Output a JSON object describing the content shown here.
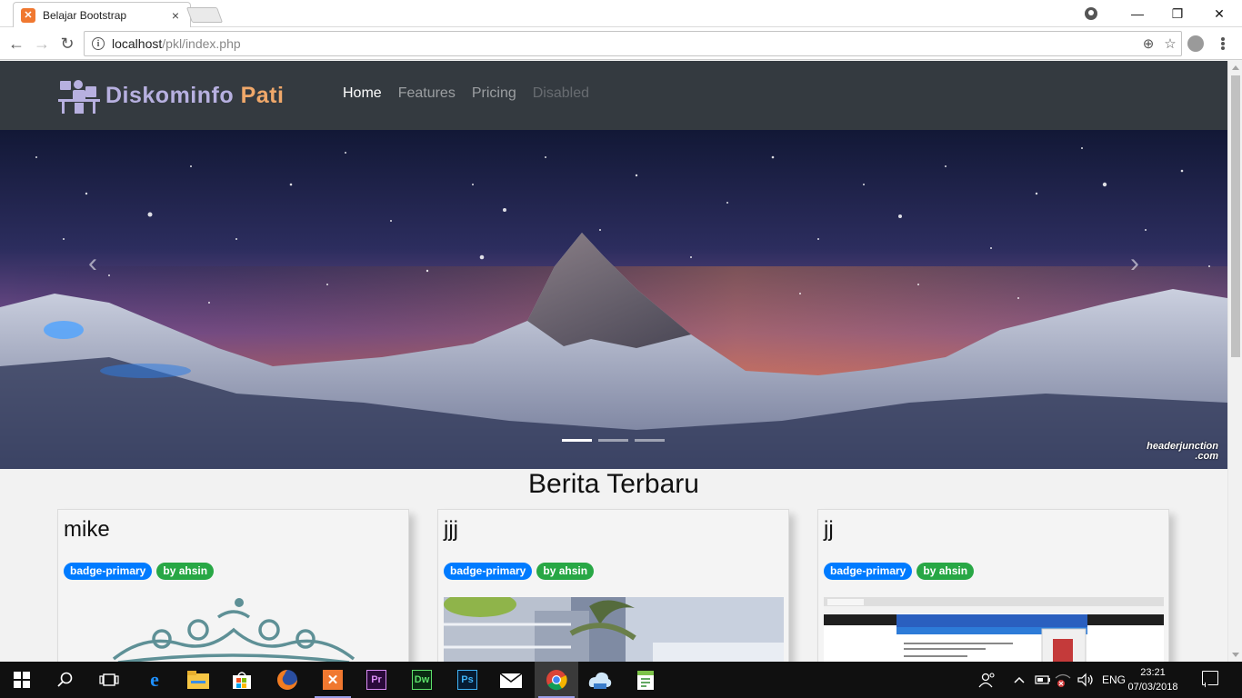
{
  "browser": {
    "tab_title": "Belajar Bootstrap",
    "tab_close": "×",
    "url_host": "localhost",
    "url_path": "/pkl/index.php",
    "window_minimize": "—",
    "window_maximize": "❐",
    "window_close": "✕"
  },
  "site": {
    "brand_word1": "Diskominfo",
    "brand_word2": "Pati",
    "nav": [
      {
        "label": "Home",
        "state": "active"
      },
      {
        "label": "Features",
        "state": "normal"
      },
      {
        "label": "Pricing",
        "state": "normal"
      },
      {
        "label": "Disabled",
        "state": "disabled"
      }
    ],
    "carousel": {
      "prev_glyph": "‹",
      "next_glyph": "›",
      "slides_count": 3,
      "active_slide": 1,
      "watermark_line1": "headerjunction",
      "watermark_line2": ".com"
    },
    "section_title": "Berita Terbaru",
    "cards": [
      {
        "title": "mike",
        "badge1": "badge-primary",
        "badge2": "by ahsin"
      },
      {
        "title": "jjj",
        "badge1": "badge-primary",
        "badge2": "by ahsin"
      },
      {
        "title": "jj",
        "badge1": "badge-primary",
        "badge2": "by ahsin"
      }
    ]
  },
  "taskbar": {
    "apps": [
      "start",
      "search",
      "task-view",
      "edge",
      "file-explorer",
      "store",
      "firefox",
      "xampp",
      "premiere",
      "dreamweaver",
      "photoshop",
      "mail",
      "chrome",
      "app-cloud",
      "notepad"
    ],
    "language": "ENG",
    "time": "23:21",
    "date": "07/03/2018"
  },
  "colors": {
    "navbar_bg": "#343a40",
    "badge_primary": "#007bff",
    "badge_success": "#28a745",
    "brand_word1": "#b7b0e0",
    "brand_word2": "#f0a86a"
  }
}
